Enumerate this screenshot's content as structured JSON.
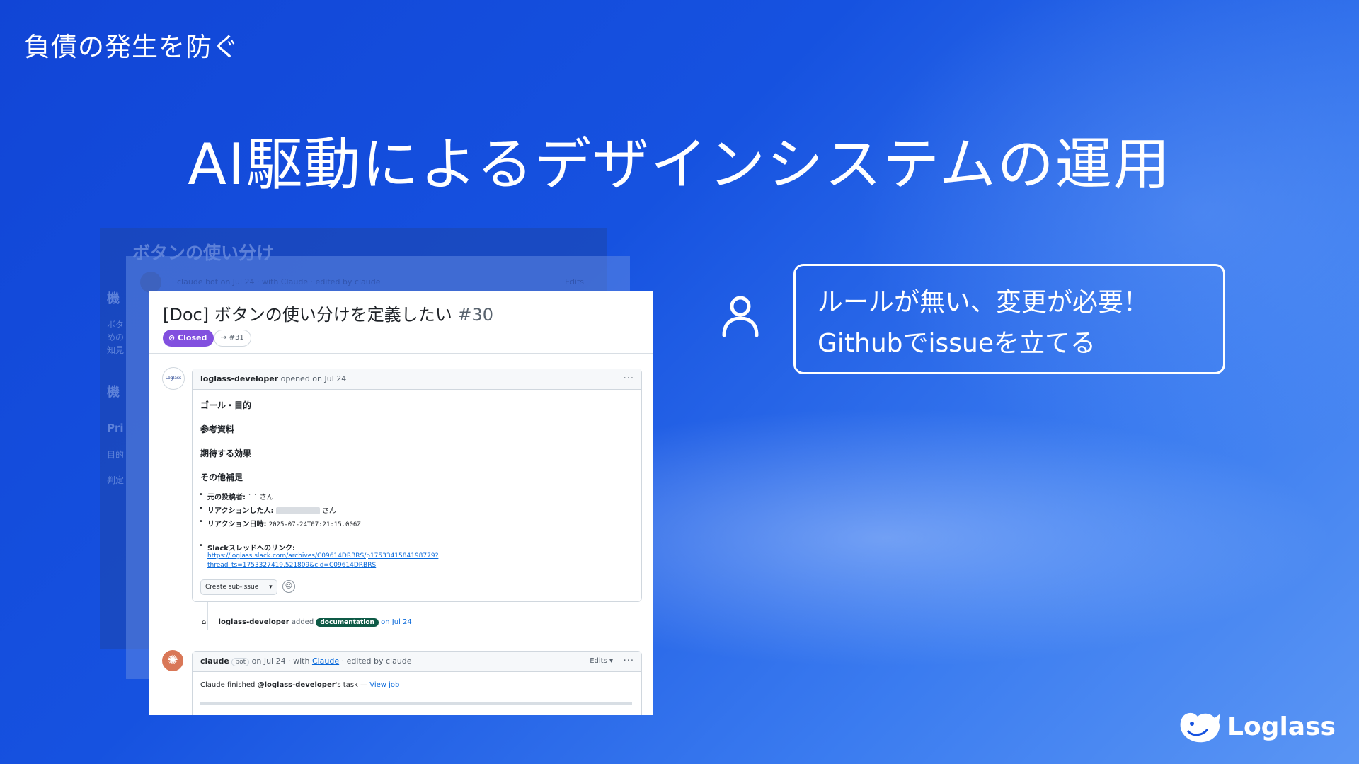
{
  "slide": {
    "section_label": "負債の発生を防ぐ",
    "title": "AI駆動によるデザインシステムの運用"
  },
  "background_cards": {
    "ghost_title": "ボタンの使い分け",
    "ghost_meta": "claude  bot  on Jul 24 · with Claude · edited by claude",
    "ghost_meta_edits": "Edits",
    "side_fragments": [
      "機",
      "ボタ",
      "めの",
      "知見",
      "機",
      "Pri",
      "目的",
      "判定"
    ]
  },
  "issue": {
    "title": "[Doc] ボタンの使い分けを定義したい",
    "number": "#30",
    "status": "Closed",
    "linked_pr": "#31",
    "author_avatar_text": "Loglass",
    "opener": {
      "user": "loglass-developer",
      "action": "opened on Jul 24"
    },
    "headings": [
      "ゴール・目的",
      "参考資料",
      "期待する効果",
      "その他補足"
    ],
    "details": {
      "poster_label": "元の投稿者:",
      "poster_value": "` `",
      "poster_suffix": "さん",
      "reactor_label": "リアクションした人:",
      "reactor_suffix": "さん",
      "reaction_time_label": "リアクション日時:",
      "reaction_time_value": "2025-07-24T07:21:15.006Z",
      "slack_label": "Slackスレッドへのリンク:",
      "slack_link_line1": "https://loglass.slack.com/archives/C09614DRBRS/p1753341584198779?",
      "slack_link_line2": "thread_ts=1753327419.521809&cid=C09614DRBRS"
    },
    "sub_issue_button": "Create sub-issue",
    "label_event": {
      "user": "loglass-developer",
      "action": "added",
      "label": "documentation",
      "date": "on Jul 24"
    },
    "claude_comment": {
      "user": "claude",
      "bot_tag": "bot",
      "meta_prefix": "on Jul 24 · with",
      "meta_link": "Claude",
      "meta_suffix": "· edited by claude",
      "edits": "Edits",
      "text_prefix": "Claude finished",
      "mention": "@loglass-developer",
      "text_suffix": "'s task —",
      "view_link": "View job"
    }
  },
  "callout": {
    "line1": "ルールが無い、変更が必要！",
    "line2": "Githubでissueを立てる"
  },
  "brand": {
    "logo_text": "Loglass",
    "icon": "loglass-bird-icon"
  },
  "colors": {
    "bg_blue": "#1652e0",
    "closed_purple": "#8250df",
    "doc_label_green": "#0e5a46",
    "link_blue": "#0969da",
    "claude_orange": "#d97757"
  }
}
